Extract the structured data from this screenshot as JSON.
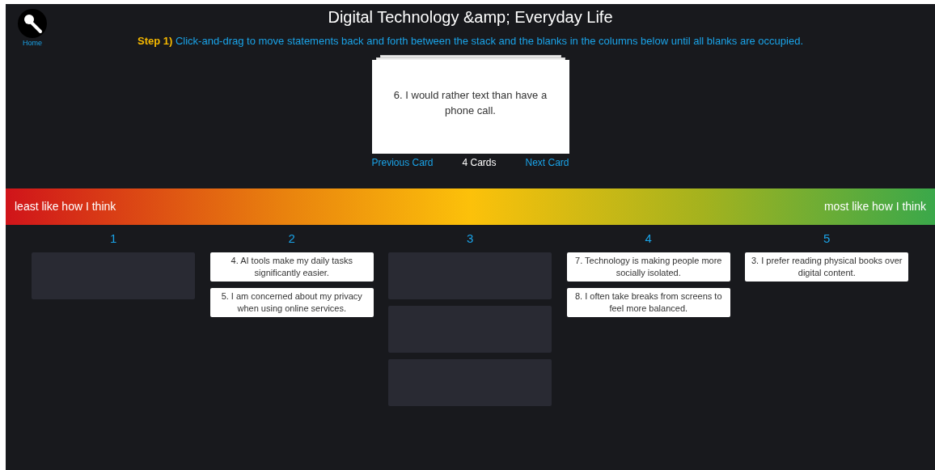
{
  "home": {
    "label": "Home"
  },
  "title": "Digital Technology &amp; Everyday Life",
  "instruction": {
    "step": "Step 1)",
    "text": "Click-and-drag to move statements back and forth between the stack and the blanks in the columns below until all blanks are occupied."
  },
  "stack": {
    "card": "6. I would rather text than have a phone call.",
    "previous": "Previous Card",
    "count": "4 Cards",
    "next": "Next Card"
  },
  "scale": {
    "left": "least like how I think",
    "right": "most like how I think"
  },
  "columns": [
    {
      "label": "1",
      "slots": [
        {
          "kind": "blank"
        }
      ]
    },
    {
      "label": "2",
      "slots": [
        {
          "kind": "card",
          "text": "4. AI tools make my daily tasks significantly easier."
        },
        {
          "kind": "card",
          "text": "5. I am concerned about my privacy when using online services."
        }
      ]
    },
    {
      "label": "3",
      "slots": [
        {
          "kind": "blank"
        },
        {
          "kind": "blank"
        },
        {
          "kind": "blank"
        }
      ]
    },
    {
      "label": "4",
      "slots": [
        {
          "kind": "card",
          "text": "7. Technology is making people more socially isolated."
        },
        {
          "kind": "card",
          "text": "8. I often take breaks from screens to feel more balanced."
        }
      ]
    },
    {
      "label": "5",
      "slots": [
        {
          "kind": "card",
          "text": "3. I prefer reading physical books over digital content."
        }
      ]
    }
  ]
}
